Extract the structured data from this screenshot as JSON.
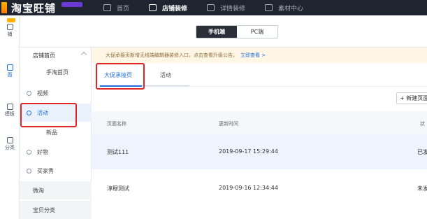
{
  "topbar": {
    "logo_text": "淘宝旺铺",
    "nav": [
      {
        "label": "首页",
        "icon": "home-icon"
      },
      {
        "label": "店铺装修",
        "icon": "shop-icon",
        "active": true
      },
      {
        "label": "详情装修",
        "icon": "detail-icon"
      },
      {
        "label": "素材中心",
        "icon": "image-icon"
      }
    ]
  },
  "rail": {
    "items": [
      {
        "label": "铺",
        "icon": "user-icon"
      },
      {
        "label": "面",
        "icon": "page-icon",
        "active": true
      },
      {
        "label": "模板",
        "icon": "template-icon"
      },
      {
        "label": "分类",
        "icon": "category-icon"
      }
    ]
  },
  "device": {
    "mobile_label": "手机端",
    "pc_label": "PC端"
  },
  "sidebar": {
    "header": "店铺首页",
    "items": [
      {
        "label": "手淘首页",
        "kind": "sub"
      },
      {
        "label": "视频",
        "kind": "iconed",
        "icon": "video-icon"
      },
      {
        "label": "活动",
        "kind": "iconed",
        "icon": "activity-icon",
        "active": true
      },
      {
        "label": "新品",
        "kind": "sub"
      },
      {
        "label": "好物",
        "kind": "iconed",
        "icon": "goods-icon"
      },
      {
        "label": "买家秀",
        "kind": "iconed",
        "icon": "buyer-show-icon"
      },
      {
        "label": "微淘",
        "kind": "plain"
      },
      {
        "label": "宝贝分类",
        "kind": "plain"
      }
    ]
  },
  "main": {
    "notice_text": "大促承接页新增无线端编辑器装修入口，点击查看升级公告，",
    "notice_link": "立即查看 >",
    "tabs": [
      "大促承接页",
      "活动"
    ],
    "new_page_label": "+ 新建页面",
    "table": {
      "headers": [
        "页面名称",
        "更新时间",
        "状"
      ],
      "rows": [
        {
          "name": "测试111",
          "time": "2019-09-17 15:29:44",
          "status": "已发"
        },
        {
          "name": "淳穆测试",
          "time": "2019-09-16 12:34:44",
          "status": "未发"
        }
      ]
    }
  },
  "colors": {
    "accent": "#1f6fe0",
    "topbar_bg": "#1f2530",
    "highlight_box": "#e02525",
    "notice_bg": "#fff6e6"
  }
}
